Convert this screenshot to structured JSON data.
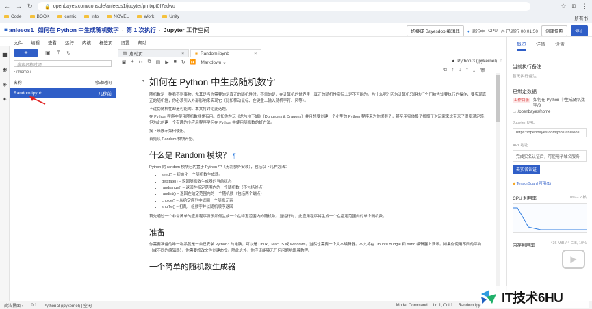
{
  "browser": {
    "url": "openbayes.com/console/anleeos1/jupyter/pmtxpt0I7adwu",
    "bookmarks": [
      "Code",
      "BOOK",
      "comic",
      "Info",
      "NOVEL",
      "Work",
      "Unity"
    ],
    "bookmarks_right": "所有书"
  },
  "header": {
    "logo": "■",
    "user": "anleeos1",
    "project": "如何在 Python 中生成随机数字",
    "run": "第 1 次执行",
    "workspace_prefix": "Jupyter",
    "workspace_suffix": "工作空间",
    "switch_editor": "切换成 Bayesdob 编辑器",
    "status": "运行中",
    "cpu": "CPU",
    "timer": "已运行 00:01:50",
    "snapshot": "创建快照",
    "stop": "停止"
  },
  "menu": [
    "文件",
    "编辑",
    "查看",
    "运行",
    "内核",
    "标签页",
    "设置",
    "帮助"
  ],
  "filebrowser": {
    "new_label": "+",
    "search_placeholder": "搜索名称过滤",
    "path": "/ home /",
    "col_name": "名称",
    "col_modified": "修改时间",
    "file_name": "Random.ipynb",
    "file_time": "几秒前"
  },
  "tabs": [
    {
      "label": "启动页"
    },
    {
      "label": "Random.ipynb"
    }
  ],
  "notebook": {
    "cell_type": "Markdown",
    "kernel": "Python 3 (ipykernel)",
    "h1": "如何在 Python 中生成随机数字",
    "p1": "随机数是一种看不到事物，尤其是当你需要的是真正的随机性时。不幸的是，在计算机的世界里，真正的随机性实际上是不可能的。为什么呢？因为计算机只能执行它们被告知要执行的操作，要实现真正的随机性，你必须引入外部影响来实现它（比如移动鼠标、在键盘上输入随机字符、风等）。",
    "p2": "不过伪随机性却是可能的。本文将讨论此话题。",
    "p3": "在 Python 程序中使用随机数非常有用。假如你在玩《龙与地下城》（Dungeons & Dragons）并且想要创建一个小型的 Python 程序来为你掷骰子，甚至用实体骰子掷骰子对玩家来说带来了很多满足感，但为此创建一个有趣的小应用程序学习在 Python 中使用随机数的好方法。",
    "p4": "接下来展示如何使用。",
    "p5": "首先从 Random 模块开始。",
    "h2a": "什么是 Random 模块？",
    "pilcrow": "¶",
    "p6": "Python 的 random 模块已内置于 Python 中（无需额外安装），包括以下几种方法：",
    "list": [
      "seed() – 初始化一个随机数生成器。",
      "getstate() – 返回随机数生成器的当前状态",
      "randrange() – 返回在指定范围内的一个随机数（不包括终点）",
      "randint() – 返回在给定范围内的一个随机数（包括两个端点）",
      "choice() – 从给定序列中返回一个随机元素",
      "shuffle() – 打乱一组数字并以随机顺序返回"
    ],
    "p7": "首先通过一个非常简单的应用程序演示如何生成一个在特定范围内的随机数。当运行时，此应用程序将生成一个在指定范围内的单个随机数。",
    "h2b": "准备",
    "p8": "你需要准备的唯一物品就是一台已安装 Python3 的电脑，可以是 Linux、MacOS 或 Windows。当然也需要一个文本编辑器。本文将在 Ubuntu Budgie 和 nano 编辑器上演示。如果你使用不同的平台（或不同的编辑器），你需要修改文件创建命令。除此之外，你应该能够无任何问题地跟着教程。",
    "h2c": "一个简单的随机数生成器"
  },
  "sidebar": {
    "tabs": [
      "概览",
      "详情",
      "设置"
    ],
    "note_title": "当前执行备注",
    "note_placeholder": "暂无执行备注",
    "binding_title": "已绑定数据",
    "tag": "工作目录",
    "bind_name": "如何在 Python 中生成随机数字/3",
    "bind_path": "→ /openbayes/home",
    "jupyter_url_label": "Jupyter URL",
    "jupyter_url": "https://openbayes.com/jobs/anleeos",
    "api_label": "API 地址",
    "api_value": "完成实名认证后，可使用子域名服务",
    "auth_btn": "去实名认证",
    "tensorboard": "TensorBoard 可用(1)",
    "cpu_label": "CPU 利用率",
    "cpu_value": "0% – 2 核",
    "mem_label": "内存利用率",
    "mem_value": "436 MiB / 4 GiB, 10%"
  },
  "status": {
    "simple": "简洁界面",
    "counts": "0   1",
    "kernel": "Python 3 (ipykernel) | 空闲",
    "mode": "Mode: Command",
    "pos": "Ln 1, Col 1",
    "file": "Random.ipyn"
  },
  "watermark": {
    "text": "IT技术6HU"
  },
  "colors": {
    "accent": "#2f5ec7",
    "sidebar_tag": "#d94444"
  }
}
